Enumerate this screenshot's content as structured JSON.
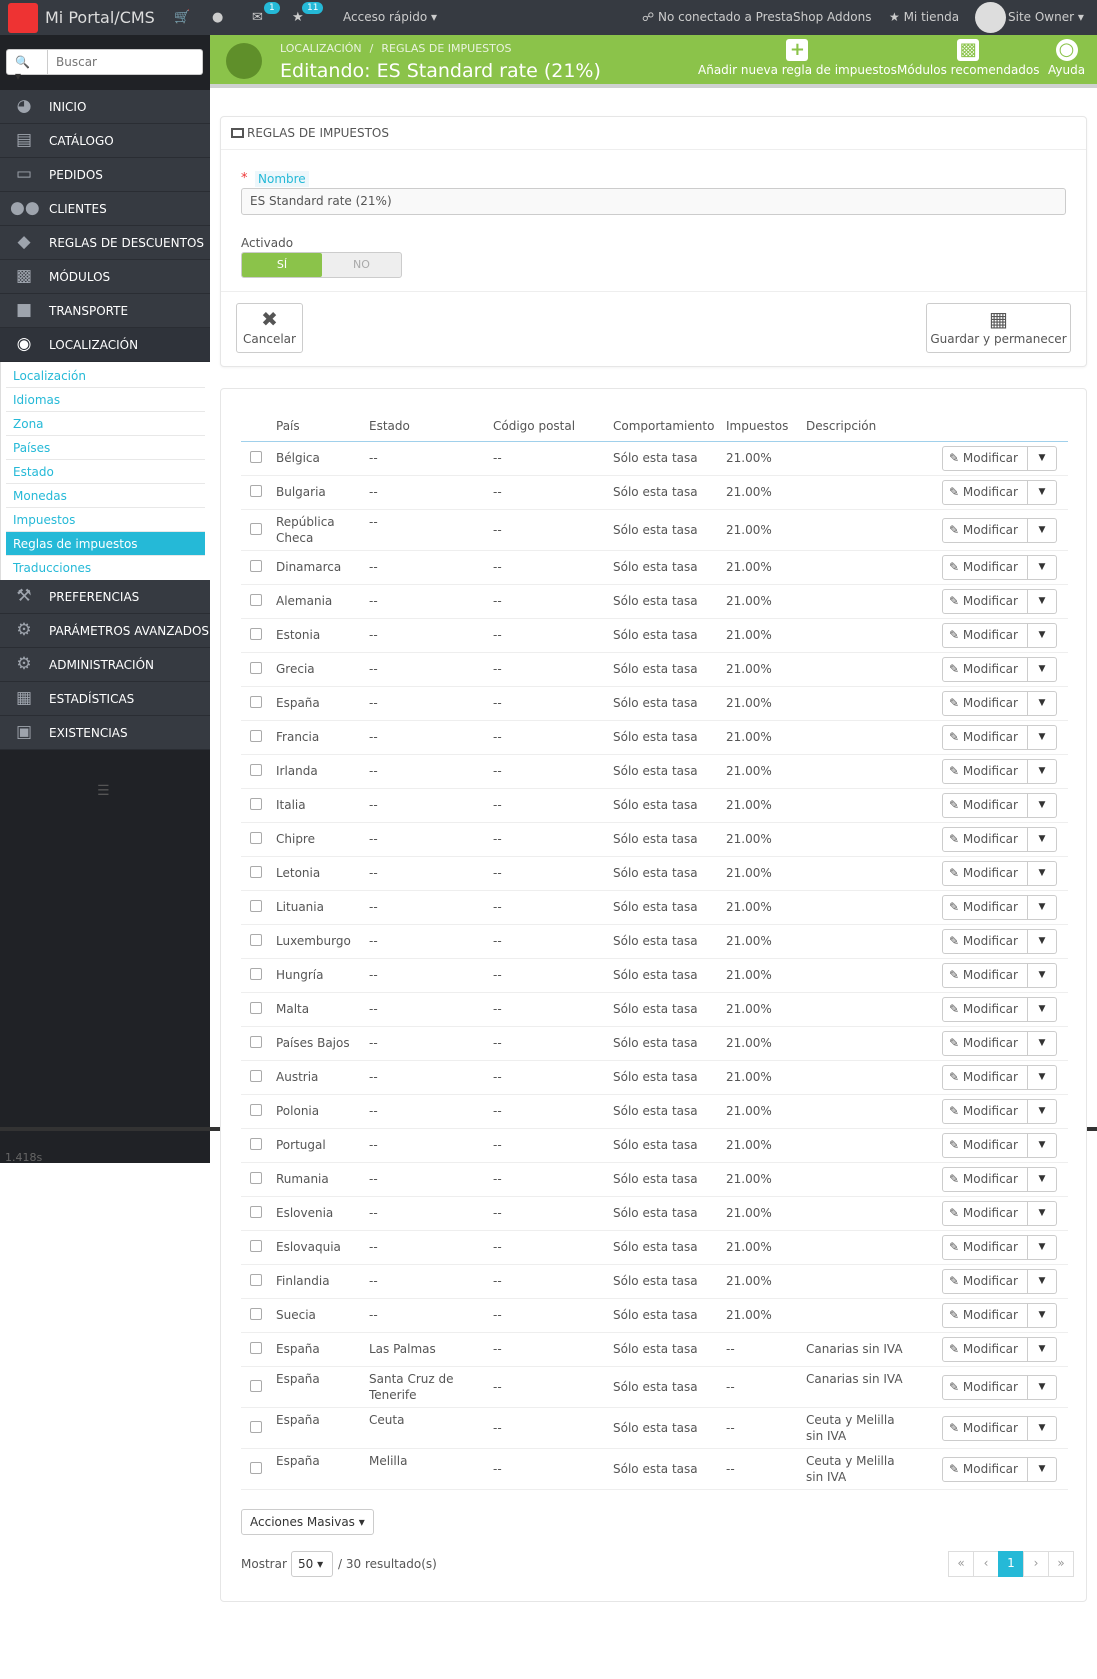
{
  "topbar": {
    "brand": "Mi Portal/CMS",
    "icons": [
      "pointer-hand-icon",
      "cart-icon",
      "user-icon",
      "mail-icon",
      "trophy-icon"
    ],
    "mail_badge": "1",
    "trophy_badge": "11",
    "quick_access": "Acceso rápido",
    "addons": "No conectado a PrestaShop Addons",
    "shop": "Mi tienda",
    "owner": "Site Owner"
  },
  "search": {
    "placeholder": "Buscar"
  },
  "sidebar": {
    "items": [
      {
        "label": "INICIO",
        "icon": "dashboard-icon"
      },
      {
        "label": "CATÁLOGO",
        "icon": "book-icon"
      },
      {
        "label": "PEDIDOS",
        "icon": "credit-card-icon"
      },
      {
        "label": "CLIENTES",
        "icon": "users-icon"
      },
      {
        "label": "REGLAS DE DESCUENTOS",
        "icon": "tags-icon"
      },
      {
        "label": "MÓDULOS",
        "icon": "puzzle-icon"
      },
      {
        "label": "TRANSPORTE",
        "icon": "truck-icon"
      },
      {
        "label": "LOCALIZACIÓN",
        "icon": "globe-icon"
      }
    ],
    "sub_items": [
      "Localización",
      "Idiomas",
      "Zona",
      "Países",
      "Estado",
      "Monedas",
      "Impuestos",
      "Reglas de impuestos",
      "Traducciones"
    ],
    "bottom_items": [
      {
        "label": "PREFERENCIAS",
        "icon": "wrench-icon"
      },
      {
        "label": "PARÁMETROS AVANZADOS",
        "icon": "cogs-icon"
      },
      {
        "label": "ADMINISTRACIÓN",
        "icon": "cog-icon"
      },
      {
        "label": "ESTADÍSTICAS",
        "icon": "bar-chart-icon"
      },
      {
        "label": "EXISTENCIAS",
        "icon": "archive-icon"
      }
    ],
    "timing": "1.418s"
  },
  "header": {
    "crumb1": "LOCALIZACIÓN",
    "crumb2": "REGLAS DE IMPUESTOS",
    "title": "Editando: ES Standard rate (21%)",
    "add_rule": "Añadir nueva regla de impuestos",
    "modules": "Módulos recomendados",
    "help": "Ayuda"
  },
  "form": {
    "panel_title": "REGLAS DE IMPUESTOS",
    "name_label": "Nombre",
    "name_value": "ES Standard rate (21%)",
    "active_label": "Activado",
    "yes": "SÍ",
    "no": "NO",
    "cancel": "Cancelar",
    "save": "Guardar y permanecer"
  },
  "table": {
    "headers": [
      "País",
      "Estado",
      "Código postal",
      "Comportamiento",
      "Impuestos",
      "Descripción"
    ],
    "modify": "Modificar",
    "rows": [
      [
        "Bélgica",
        "--",
        "--",
        "Sólo esta tasa",
        "21.00%",
        ""
      ],
      [
        "Bulgaria",
        "--",
        "--",
        "Sólo esta tasa",
        "21.00%",
        ""
      ],
      [
        "República Checa",
        "--",
        "--",
        "Sólo esta tasa",
        "21.00%",
        ""
      ],
      [
        "Dinamarca",
        "--",
        "--",
        "Sólo esta tasa",
        "21.00%",
        ""
      ],
      [
        "Alemania",
        "--",
        "--",
        "Sólo esta tasa",
        "21.00%",
        ""
      ],
      [
        "Estonia",
        "--",
        "--",
        "Sólo esta tasa",
        "21.00%",
        ""
      ],
      [
        "Grecia",
        "--",
        "--",
        "Sólo esta tasa",
        "21.00%",
        ""
      ],
      [
        "España",
        "--",
        "--",
        "Sólo esta tasa",
        "21.00%",
        ""
      ],
      [
        "Francia",
        "--",
        "--",
        "Sólo esta tasa",
        "21.00%",
        ""
      ],
      [
        "Irlanda",
        "--",
        "--",
        "Sólo esta tasa",
        "21.00%",
        ""
      ],
      [
        "Italia",
        "--",
        "--",
        "Sólo esta tasa",
        "21.00%",
        ""
      ],
      [
        "Chipre",
        "--",
        "--",
        "Sólo esta tasa",
        "21.00%",
        ""
      ],
      [
        "Letonia",
        "--",
        "--",
        "Sólo esta tasa",
        "21.00%",
        ""
      ],
      [
        "Lituania",
        "--",
        "--",
        "Sólo esta tasa",
        "21.00%",
        ""
      ],
      [
        "Luxemburgo",
        "--",
        "--",
        "Sólo esta tasa",
        "21.00%",
        ""
      ],
      [
        "Hungría",
        "--",
        "--",
        "Sólo esta tasa",
        "21.00%",
        ""
      ],
      [
        "Malta",
        "--",
        "--",
        "Sólo esta tasa",
        "21.00%",
        ""
      ],
      [
        "Países Bajos",
        "--",
        "--",
        "Sólo esta tasa",
        "21.00%",
        ""
      ],
      [
        "Austria",
        "--",
        "--",
        "Sólo esta tasa",
        "21.00%",
        ""
      ],
      [
        "Polonia",
        "--",
        "--",
        "Sólo esta tasa",
        "21.00%",
        ""
      ],
      [
        "Portugal",
        "--",
        "--",
        "Sólo esta tasa",
        "21.00%",
        ""
      ],
      [
        "Rumania",
        "--",
        "--",
        "Sólo esta tasa",
        "21.00%",
        ""
      ],
      [
        "Eslovenia",
        "--",
        "--",
        "Sólo esta tasa",
        "21.00%",
        ""
      ],
      [
        "Eslovaquia",
        "--",
        "--",
        "Sólo esta tasa",
        "21.00%",
        ""
      ],
      [
        "Finlandia",
        "--",
        "--",
        "Sólo esta tasa",
        "21.00%",
        ""
      ],
      [
        "Suecia",
        "--",
        "--",
        "Sólo esta tasa",
        "21.00%",
        ""
      ],
      [
        "España",
        "Las Palmas",
        "--",
        "Sólo esta tasa",
        "--",
        "Canarias sin IVA"
      ],
      [
        "España",
        "Santa Cruz de Tenerife",
        "--",
        "Sólo esta tasa",
        "--",
        "Canarias sin IVA"
      ],
      [
        "España",
        "Ceuta",
        "--",
        "Sólo esta tasa",
        "--",
        "Ceuta y Melilla sin IVA"
      ],
      [
        "España",
        "Melilla",
        "--",
        "Sólo esta tasa",
        "--",
        "Ceuta y Melilla sin IVA"
      ]
    ]
  },
  "footer": {
    "bulk": "Acciones Masivas",
    "show": "Mostrar",
    "per_page": "50",
    "results": "/ 30 resultado(s)",
    "page": "1"
  }
}
